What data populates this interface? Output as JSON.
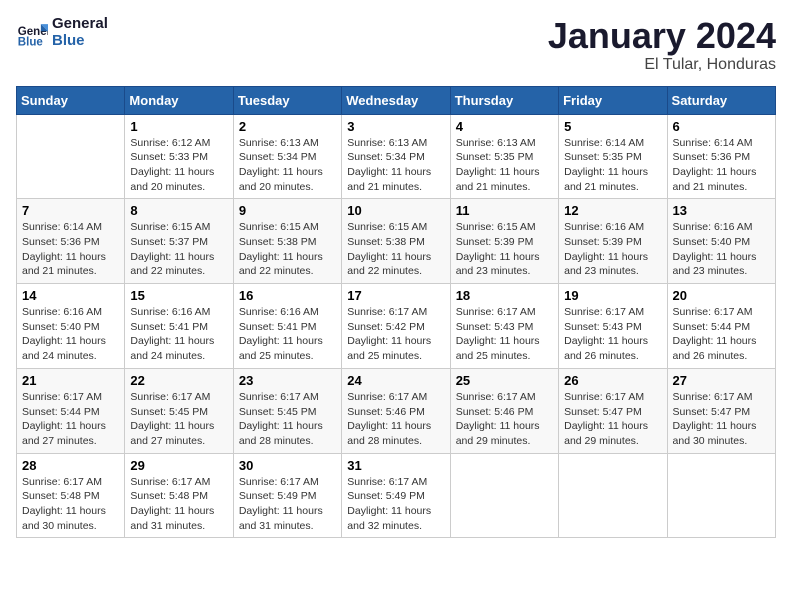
{
  "logo": {
    "line1": "General",
    "line2": "Blue"
  },
  "title": "January 2024",
  "location": "El Tular, Honduras",
  "weekdays": [
    "Sunday",
    "Monday",
    "Tuesday",
    "Wednesday",
    "Thursday",
    "Friday",
    "Saturday"
  ],
  "weeks": [
    [
      {
        "num": "",
        "detail": ""
      },
      {
        "num": "1",
        "detail": "Sunrise: 6:12 AM\nSunset: 5:33 PM\nDaylight: 11 hours\nand 20 minutes."
      },
      {
        "num": "2",
        "detail": "Sunrise: 6:13 AM\nSunset: 5:34 PM\nDaylight: 11 hours\nand 20 minutes."
      },
      {
        "num": "3",
        "detail": "Sunrise: 6:13 AM\nSunset: 5:34 PM\nDaylight: 11 hours\nand 21 minutes."
      },
      {
        "num": "4",
        "detail": "Sunrise: 6:13 AM\nSunset: 5:35 PM\nDaylight: 11 hours\nand 21 minutes."
      },
      {
        "num": "5",
        "detail": "Sunrise: 6:14 AM\nSunset: 5:35 PM\nDaylight: 11 hours\nand 21 minutes."
      },
      {
        "num": "6",
        "detail": "Sunrise: 6:14 AM\nSunset: 5:36 PM\nDaylight: 11 hours\nand 21 minutes."
      }
    ],
    [
      {
        "num": "7",
        "detail": "Sunrise: 6:14 AM\nSunset: 5:36 PM\nDaylight: 11 hours\nand 21 minutes."
      },
      {
        "num": "8",
        "detail": "Sunrise: 6:15 AM\nSunset: 5:37 PM\nDaylight: 11 hours\nand 22 minutes."
      },
      {
        "num": "9",
        "detail": "Sunrise: 6:15 AM\nSunset: 5:38 PM\nDaylight: 11 hours\nand 22 minutes."
      },
      {
        "num": "10",
        "detail": "Sunrise: 6:15 AM\nSunset: 5:38 PM\nDaylight: 11 hours\nand 22 minutes."
      },
      {
        "num": "11",
        "detail": "Sunrise: 6:15 AM\nSunset: 5:39 PM\nDaylight: 11 hours\nand 23 minutes."
      },
      {
        "num": "12",
        "detail": "Sunrise: 6:16 AM\nSunset: 5:39 PM\nDaylight: 11 hours\nand 23 minutes."
      },
      {
        "num": "13",
        "detail": "Sunrise: 6:16 AM\nSunset: 5:40 PM\nDaylight: 11 hours\nand 23 minutes."
      }
    ],
    [
      {
        "num": "14",
        "detail": "Sunrise: 6:16 AM\nSunset: 5:40 PM\nDaylight: 11 hours\nand 24 minutes."
      },
      {
        "num": "15",
        "detail": "Sunrise: 6:16 AM\nSunset: 5:41 PM\nDaylight: 11 hours\nand 24 minutes."
      },
      {
        "num": "16",
        "detail": "Sunrise: 6:16 AM\nSunset: 5:41 PM\nDaylight: 11 hours\nand 25 minutes."
      },
      {
        "num": "17",
        "detail": "Sunrise: 6:17 AM\nSunset: 5:42 PM\nDaylight: 11 hours\nand 25 minutes."
      },
      {
        "num": "18",
        "detail": "Sunrise: 6:17 AM\nSunset: 5:43 PM\nDaylight: 11 hours\nand 25 minutes."
      },
      {
        "num": "19",
        "detail": "Sunrise: 6:17 AM\nSunset: 5:43 PM\nDaylight: 11 hours\nand 26 minutes."
      },
      {
        "num": "20",
        "detail": "Sunrise: 6:17 AM\nSunset: 5:44 PM\nDaylight: 11 hours\nand 26 minutes."
      }
    ],
    [
      {
        "num": "21",
        "detail": "Sunrise: 6:17 AM\nSunset: 5:44 PM\nDaylight: 11 hours\nand 27 minutes."
      },
      {
        "num": "22",
        "detail": "Sunrise: 6:17 AM\nSunset: 5:45 PM\nDaylight: 11 hours\nand 27 minutes."
      },
      {
        "num": "23",
        "detail": "Sunrise: 6:17 AM\nSunset: 5:45 PM\nDaylight: 11 hours\nand 28 minutes."
      },
      {
        "num": "24",
        "detail": "Sunrise: 6:17 AM\nSunset: 5:46 PM\nDaylight: 11 hours\nand 28 minutes."
      },
      {
        "num": "25",
        "detail": "Sunrise: 6:17 AM\nSunset: 5:46 PM\nDaylight: 11 hours\nand 29 minutes."
      },
      {
        "num": "26",
        "detail": "Sunrise: 6:17 AM\nSunset: 5:47 PM\nDaylight: 11 hours\nand 29 minutes."
      },
      {
        "num": "27",
        "detail": "Sunrise: 6:17 AM\nSunset: 5:47 PM\nDaylight: 11 hours\nand 30 minutes."
      }
    ],
    [
      {
        "num": "28",
        "detail": "Sunrise: 6:17 AM\nSunset: 5:48 PM\nDaylight: 11 hours\nand 30 minutes."
      },
      {
        "num": "29",
        "detail": "Sunrise: 6:17 AM\nSunset: 5:48 PM\nDaylight: 11 hours\nand 31 minutes."
      },
      {
        "num": "30",
        "detail": "Sunrise: 6:17 AM\nSunset: 5:49 PM\nDaylight: 11 hours\nand 31 minutes."
      },
      {
        "num": "31",
        "detail": "Sunrise: 6:17 AM\nSunset: 5:49 PM\nDaylight: 11 hours\nand 32 minutes."
      },
      {
        "num": "",
        "detail": ""
      },
      {
        "num": "",
        "detail": ""
      },
      {
        "num": "",
        "detail": ""
      }
    ]
  ]
}
